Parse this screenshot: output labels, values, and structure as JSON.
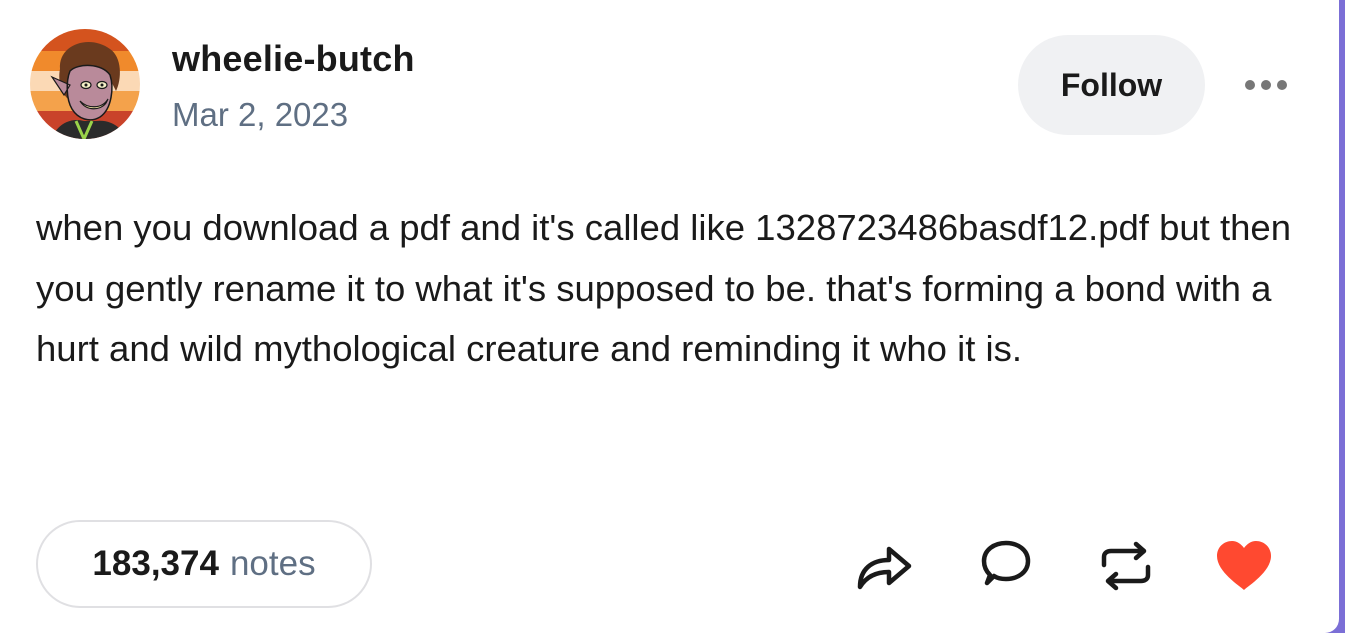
{
  "post": {
    "author": "wheelie-butch",
    "date": "Mar 2, 2023",
    "follow_label": "Follow",
    "text": "when you download a pdf and it's called like 1328723486basdf12.pdf but then you gently rename it to what it's supposed to be. that's forming a bond with a hurt and wild mythological creature and reminding it who it is.",
    "notes_count": "183,374",
    "notes_label": "notes"
  },
  "icons": {
    "more": "more-horizontal-icon",
    "share": "share-icon",
    "reply": "reply-icon",
    "reblog": "reblog-icon",
    "like": "heart-icon"
  },
  "colors": {
    "like_active": "#ff4930",
    "follow_bg": "#f0f1f3",
    "secondary_text": "#5f6f83",
    "icon": "#1a1a1a",
    "more_dots": "#777777"
  }
}
